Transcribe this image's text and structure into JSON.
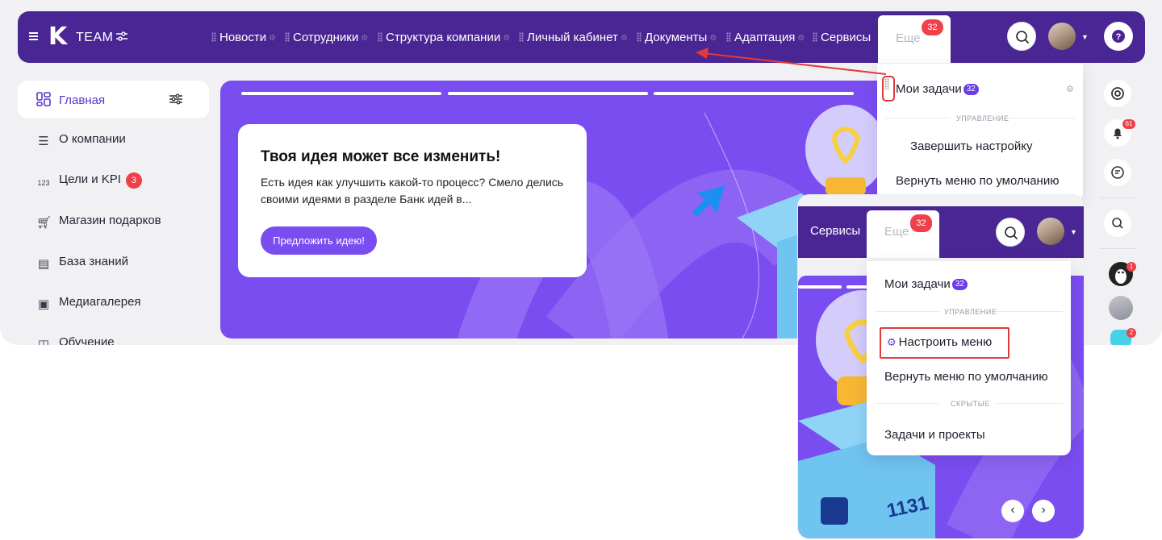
{
  "app": {
    "logo_letter": "K",
    "logo_text": "TEAM"
  },
  "nav": {
    "items": [
      {
        "label": "Новости"
      },
      {
        "label": "Сотрудники"
      },
      {
        "label": "Структура компании"
      },
      {
        "label": "Личный кабинет"
      },
      {
        "label": "Документы"
      },
      {
        "label": "Адаптация"
      },
      {
        "label": "Сервисы"
      }
    ],
    "more_label": "Еще",
    "more_badge": "32"
  },
  "sidebar": {
    "items": [
      {
        "label": "Главная",
        "icon": "grid-icon",
        "active": true
      },
      {
        "label": "О компании",
        "icon": "list-icon"
      },
      {
        "label": "Цели и KPI",
        "icon": "kpi-icon",
        "badge": "3"
      },
      {
        "label": "Магазин подарков",
        "icon": "cart-icon"
      },
      {
        "label": "База знаний",
        "icon": "book-icon"
      },
      {
        "label": "Медиагалерея",
        "icon": "image-icon"
      },
      {
        "label": "Обучение",
        "icon": "education-icon"
      }
    ]
  },
  "banner": {
    "title": "Твоя идея может все изменить!",
    "text": "Есть идея как улучшить какой-то процесс? Смело делись своими идеями в разделе Банк идей в...",
    "button_label": "Предложить идею!"
  },
  "dropdown_main": {
    "my_tasks_label": "Мои задачи",
    "my_tasks_badge": "32",
    "section_manage": "Управление",
    "finish_setup_label": "Завершить настройку",
    "reset_menu_label": "Вернуть меню по умолчанию"
  },
  "right_rail": {
    "notifications_badge": "61",
    "user1_badge": "1",
    "chat_badge": "2"
  },
  "inset": {
    "services_label": "Сервисы",
    "more_label": "Еще",
    "more_badge": "32",
    "my_tasks_label": "Мои задачи",
    "my_tasks_badge": "32",
    "section_manage": "Управление",
    "configure_menu_label": "Настроить меню",
    "reset_menu_label": "Вернуть меню по умолчанию",
    "section_hidden": "Скрытые",
    "tasks_projects_label": "Задачи и проекты"
  },
  "colors": {
    "brand_dark": "#4a2694",
    "brand": "#7a4df0",
    "badge_red": "#f0404a",
    "badge_purple": "#6a3de8",
    "annotation_red": "#e23a3a"
  }
}
